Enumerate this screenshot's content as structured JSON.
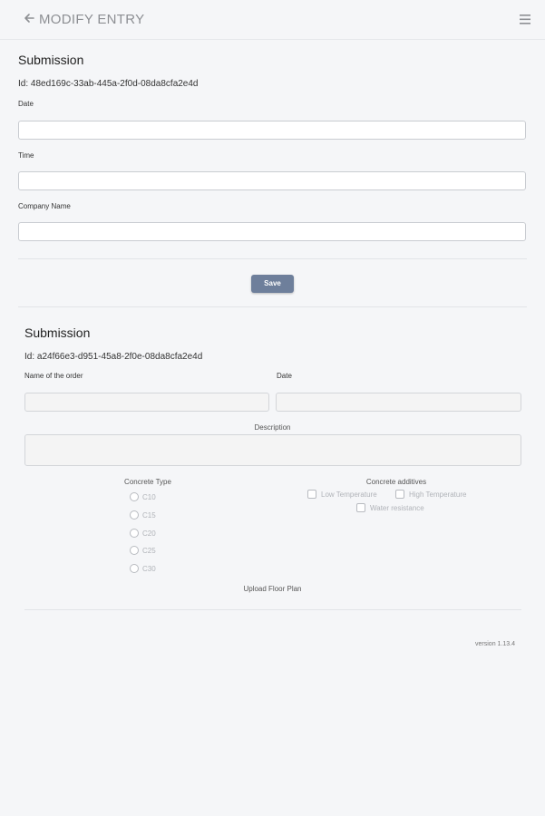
{
  "header": {
    "title": "MODIFY ENTRY",
    "back_icon": "arrow-left-icon",
    "menu_icon": "hamburger-menu-icon"
  },
  "form1": {
    "title": "Submission",
    "id": "Id: 48ed169c-33ab-445a-2f0d-08da8cfa2e4d",
    "date_label": "Date",
    "date_value": "",
    "time_label": "Time",
    "time_value": "",
    "company_label": "Company Name",
    "company_value": "",
    "save_label": "Save"
  },
  "form2": {
    "title": "Submission",
    "id": "Id: a24f66e3-d951-45a8-2f0e-08da8cfa2e4d",
    "order_name_label": "Name of the order",
    "date_label": "Date",
    "description_label": "Description",
    "concrete_type_label": "Concrete Type",
    "concrete_types": [
      "C10",
      "C15",
      "C20",
      "C25",
      "C30"
    ],
    "additives_label": "Concrete additives",
    "additives": [
      "Low Temperature",
      "High Temperature",
      "Water resistance"
    ],
    "upload_label": "Upload Floor Plan"
  },
  "footer": {
    "version": "version 1.13.4"
  },
  "colors": {
    "background": "#f5f6f8",
    "save_button": "#6e7f9b",
    "disabled_text": "#b0b3b8"
  }
}
